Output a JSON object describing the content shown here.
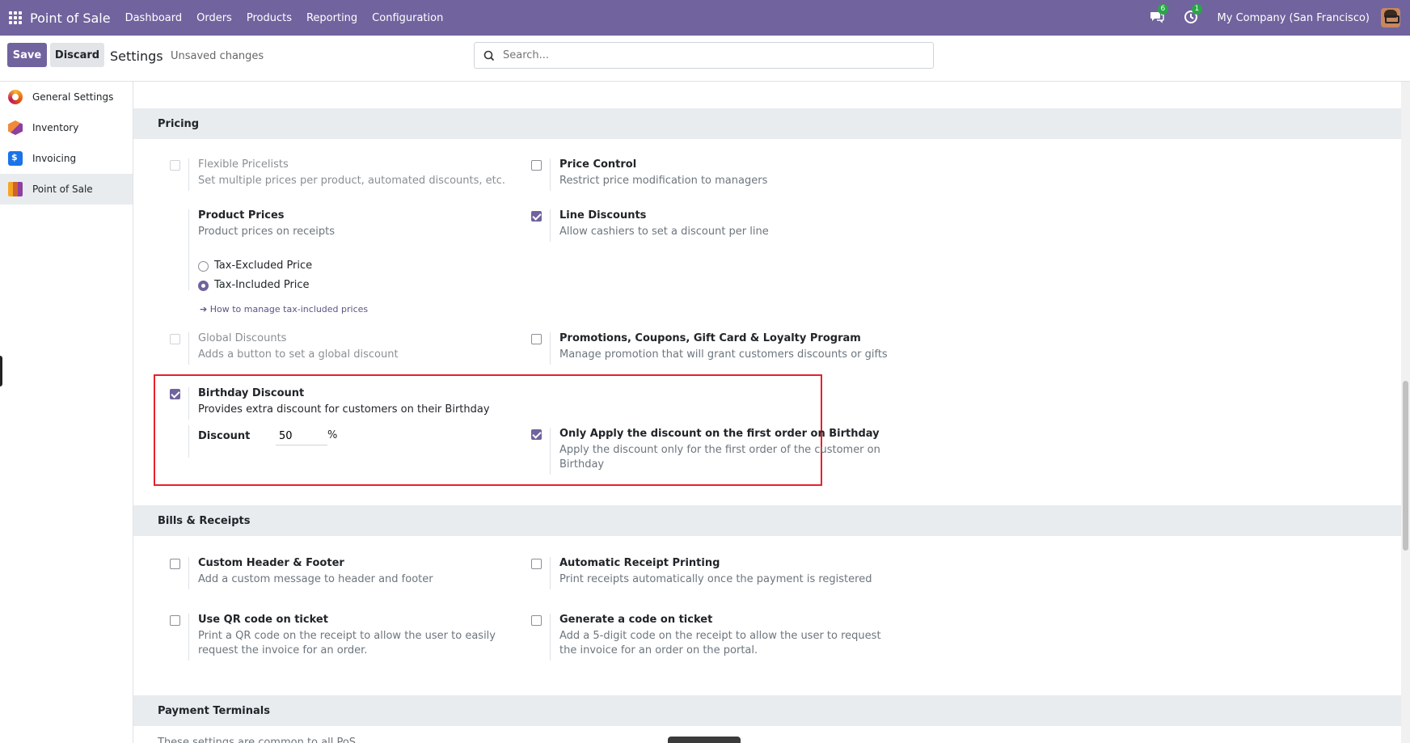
{
  "navbar": {
    "app_name": "Point of Sale",
    "menu": [
      "Dashboard",
      "Orders",
      "Products",
      "Reporting",
      "Configuration"
    ],
    "messages_badge": "6",
    "activities_badge": "1",
    "company": "My Company (San Francisco)",
    "accent": "#71639e"
  },
  "control_panel": {
    "save_label": "Save",
    "discard_label": "Discard",
    "title": "Settings",
    "status": "Unsaved changes",
    "search_placeholder": "Search..."
  },
  "sidebar": {
    "items": [
      {
        "label": "General Settings",
        "icon": "general-settings-icon"
      },
      {
        "label": "Inventory",
        "icon": "inventory-icon"
      },
      {
        "label": "Invoicing",
        "icon": "invoicing-icon"
      },
      {
        "label": "Point of Sale",
        "icon": "point-of-sale-icon",
        "active": true
      }
    ]
  },
  "pricing": {
    "heading": "Pricing",
    "flexible_pricelists": {
      "title": "Flexible Pricelists",
      "desc": "Set multiple prices per product, automated discounts, etc.",
      "checked": false
    },
    "price_control": {
      "title": "Price Control",
      "desc": "Restrict price modification to managers",
      "checked": false
    },
    "product_prices": {
      "title": "Product Prices",
      "desc": "Product prices on receipts",
      "option_excluded": "Tax-Excluded Price",
      "option_included": "Tax-Included Price",
      "selected": "Tax-Included Price",
      "link": "➔ How to manage tax-included prices"
    },
    "line_discounts": {
      "title": "Line Discounts",
      "desc": "Allow cashiers to set a discount per line",
      "checked": true
    },
    "global_discounts": {
      "title": "Global Discounts",
      "desc": "Adds a button to set a global discount",
      "checked": false
    },
    "promotions": {
      "title": "Promotions, Coupons, Gift Card & Loyalty Program",
      "desc": "Manage promotion that will grant customers discounts or gifts",
      "checked": false
    },
    "birthday_discount": {
      "title": "Birthday Discount",
      "desc": "Provides extra discount for customers on their Birthday",
      "checked": true,
      "discount_label": "Discount",
      "discount_value": "50",
      "unit": "%"
    },
    "first_order": {
      "title": "Only Apply the discount on the first order on Birthday",
      "desc_line1": "Apply the discount only for the first order of the customer on",
      "desc_line2": "Birthday",
      "checked": true
    }
  },
  "bills": {
    "heading": "Bills & Receipts",
    "custom_header": {
      "title": "Custom Header & Footer",
      "desc": "Add a custom message to header and footer",
      "checked": false
    },
    "auto_print": {
      "title": "Automatic Receipt Printing",
      "desc": "Print receipts automatically once the payment is registered",
      "checked": false
    },
    "qr_code": {
      "title": "Use QR code on ticket",
      "desc_line1": "Print a QR code on the receipt to allow the user to easily",
      "desc_line2": "request the invoice for an order.",
      "checked": false
    },
    "gen_code": {
      "title": "Generate a code on ticket",
      "desc_line1": "Add a 5-digit code on the receipt to allow the user to request",
      "desc_line2": "the invoice for an order on the portal.",
      "checked": false
    }
  },
  "payment_terminals": {
    "heading": "Payment Terminals",
    "note": "These settings are common to all PoS"
  }
}
